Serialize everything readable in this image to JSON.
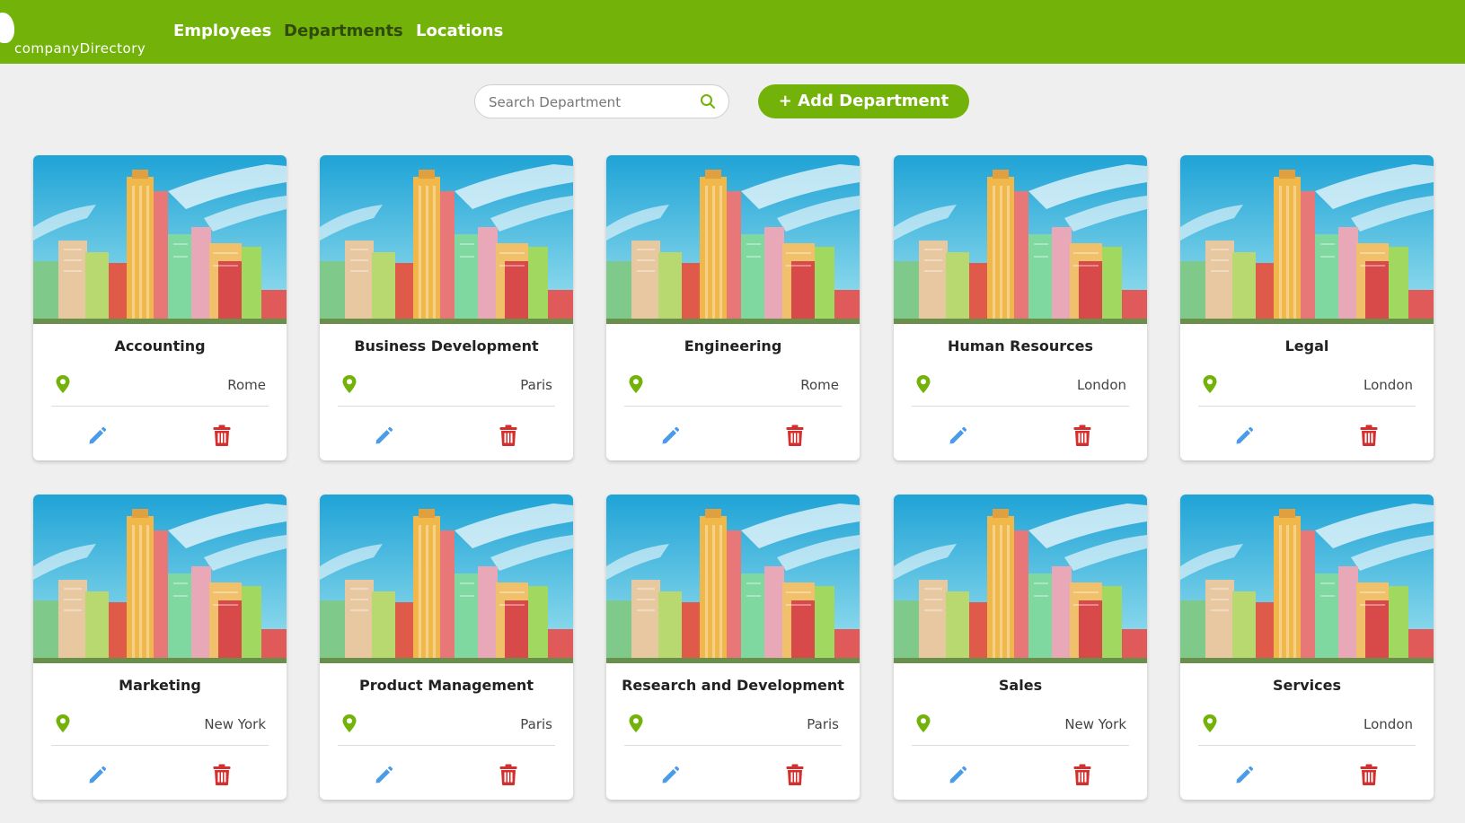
{
  "brand": {
    "name": "companyDirectory"
  },
  "nav": {
    "employees": "Employees",
    "departments": "Departments",
    "locations": "Locations"
  },
  "search": {
    "placeholder": "Search Department",
    "value": ""
  },
  "add_button": {
    "plus": "+",
    "label": "Add Department"
  },
  "colors": {
    "brand_green": "#73b309",
    "edit_blue": "#4a9be8",
    "delete_red": "#d32f2f",
    "pin_green": "#73b309"
  },
  "departments": [
    {
      "name": "Accounting",
      "location": "Rome"
    },
    {
      "name": "Business Development",
      "location": "Paris"
    },
    {
      "name": "Engineering",
      "location": "Rome"
    },
    {
      "name": "Human Resources",
      "location": "London"
    },
    {
      "name": "Legal",
      "location": "London"
    },
    {
      "name": "Marketing",
      "location": "New York"
    },
    {
      "name": "Product Management",
      "location": "Paris"
    },
    {
      "name": "Research and Development",
      "location": "Paris"
    },
    {
      "name": "Sales",
      "location": "New York"
    },
    {
      "name": "Services",
      "location": "London"
    }
  ]
}
